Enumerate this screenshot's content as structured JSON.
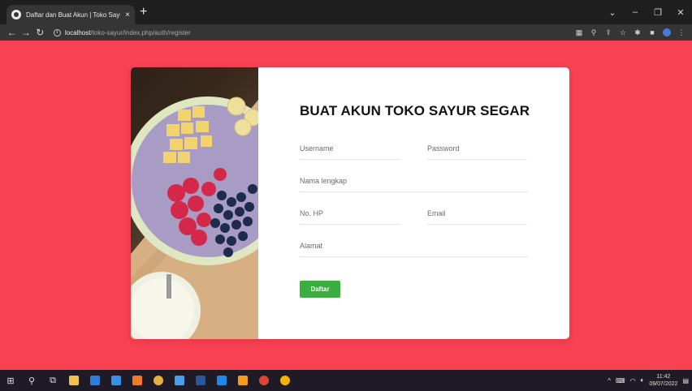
{
  "browser": {
    "tab_title": "Daftar dan Buat Akun | Toko Sayur Segar",
    "tab_close": "×",
    "new_tab": "+",
    "url_host": "localhost",
    "url_path": "/toko-sayur/index.php/auth/register",
    "window_controls": [
      "⌄",
      "–",
      "❐",
      "✕"
    ]
  },
  "form": {
    "title": "BUAT AKUN TOKO SAYUR SEGAR",
    "username_placeholder": "Username",
    "password_placeholder": "Password",
    "fullname_placeholder": "Nama lengkap",
    "phone_placeholder": "No. HP",
    "email_placeholder": "Email",
    "address_placeholder": "Alamat",
    "submit_label": "Daftar"
  },
  "taskbar": {
    "time": "11:42",
    "date": "09/07/2022"
  },
  "colors": {
    "page_background": "#f84152",
    "submit_button": "#3bae3f"
  }
}
